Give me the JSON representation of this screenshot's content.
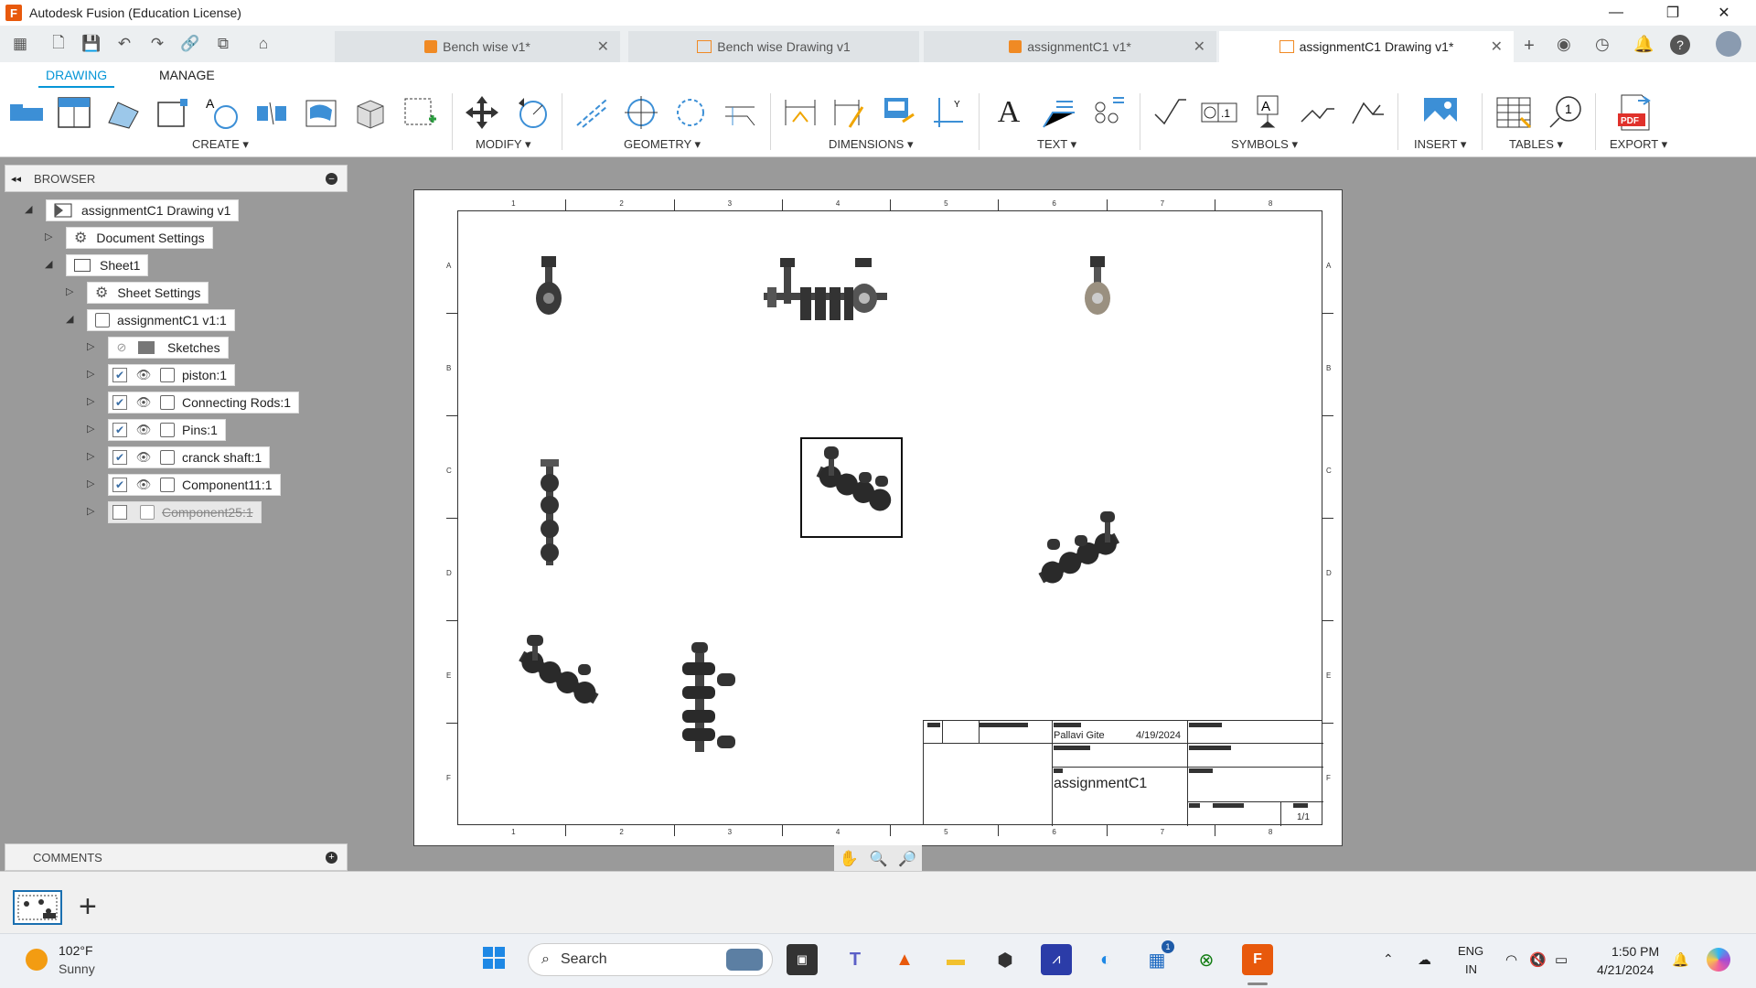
{
  "window": {
    "title": "Autodesk Fusion (Education License)"
  },
  "tabs": [
    {
      "label": "Bench wise v1*",
      "kind": "model"
    },
    {
      "label": "Bench wise Drawing v1",
      "kind": "drawing"
    },
    {
      "label": "assignmentC1 v1*",
      "kind": "model"
    },
    {
      "label": "assignmentC1 Drawing v1*",
      "kind": "drawing",
      "active": true
    }
  ],
  "ribbon": {
    "tabs": [
      "DRAWING",
      "MANAGE"
    ],
    "groups": [
      "CREATE",
      "MODIFY",
      "GEOMETRY",
      "DIMENSIONS",
      "TEXT",
      "SYMBOLS",
      "INSERT",
      "TABLES",
      "EXPORT"
    ],
    "accent": "#0696d7"
  },
  "browser": {
    "title": "BROWSER",
    "root": "assignmentC1 Drawing v1",
    "document_settings": "Document Settings",
    "sheet": "Sheet1",
    "sheet_settings": "Sheet Settings",
    "assembly": "assignmentC1 v1:1",
    "components": [
      {
        "label": "Sketches",
        "checked": null,
        "visible": false
      },
      {
        "label": "piston:1",
        "checked": true,
        "visible": true
      },
      {
        "label": "Connecting Rods:1",
        "checked": true,
        "visible": true
      },
      {
        "label": "Pins:1",
        "checked": true,
        "visible": true
      },
      {
        "label": "cranck shaft:1",
        "checked": true,
        "visible": true
      },
      {
        "label": "Component11:1",
        "checked": true,
        "visible": true
      },
      {
        "label": "Component25:1",
        "checked": false,
        "visible": false,
        "strikethrough": true
      }
    ]
  },
  "comments": {
    "title": "COMMENTS"
  },
  "sheet": {
    "columns": [
      "1",
      "2",
      "3",
      "4",
      "5",
      "6",
      "7",
      "8"
    ],
    "rows": [
      "A",
      "B",
      "C",
      "D",
      "E",
      "F"
    ],
    "title_block": {
      "author": "Pallavi Gite",
      "date": "4/19/2024",
      "title": "assignmentC1",
      "sheet_number": "1/1"
    }
  },
  "taskbar": {
    "weather_temp": "102°F",
    "weather_desc": "Sunny",
    "search_label": "Search",
    "lang_top": "ENG",
    "lang_bottom": "IN",
    "time": "1:50 PM",
    "date": "4/21/2024",
    "store_badge": "1"
  }
}
